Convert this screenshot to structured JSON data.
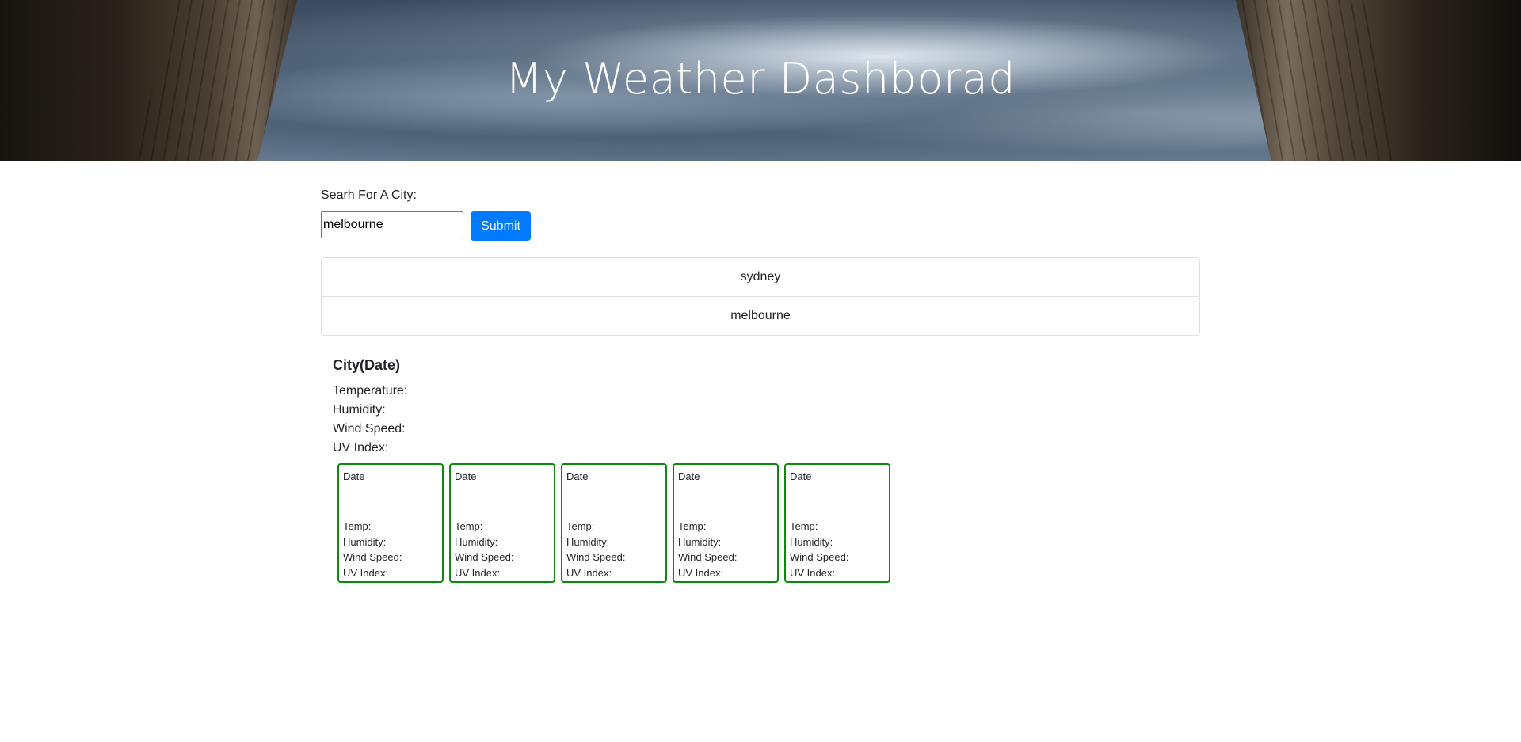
{
  "header": {
    "title": "My Weather Dashborad"
  },
  "search": {
    "label": "Searh For A City:",
    "value": "melbourne",
    "submit_label": "Submit"
  },
  "history": {
    "items": [
      {
        "label": "sydney"
      },
      {
        "label": "melbourne"
      }
    ]
  },
  "current": {
    "title": "City(Date)",
    "temperature_label": "Temperature:",
    "humidity_label": "Humidity:",
    "wind_label": "Wind Speed:",
    "uv_label": "UV Index:"
  },
  "forecast": {
    "cards": [
      {
        "date": "Date",
        "temp": "Temp:",
        "humidity": "Humidity:",
        "wind": "Wind Speed:",
        "uv": "UV Index:"
      },
      {
        "date": "Date",
        "temp": "Temp:",
        "humidity": "Humidity:",
        "wind": "Wind Speed:",
        "uv": "UV Index:"
      },
      {
        "date": "Date",
        "temp": "Temp:",
        "humidity": "Humidity:",
        "wind": "Wind Speed:",
        "uv": "UV Index:"
      },
      {
        "date": "Date",
        "temp": "Temp:",
        "humidity": "Humidity:",
        "wind": "Wind Speed:",
        "uv": "UV Index:"
      },
      {
        "date": "Date",
        "temp": "Temp:",
        "humidity": "Humidity:",
        "wind": "Wind Speed:",
        "uv": "UV Index:"
      }
    ]
  },
  "colors": {
    "accent": "#007bff",
    "card_border": "#0b8a0b"
  }
}
